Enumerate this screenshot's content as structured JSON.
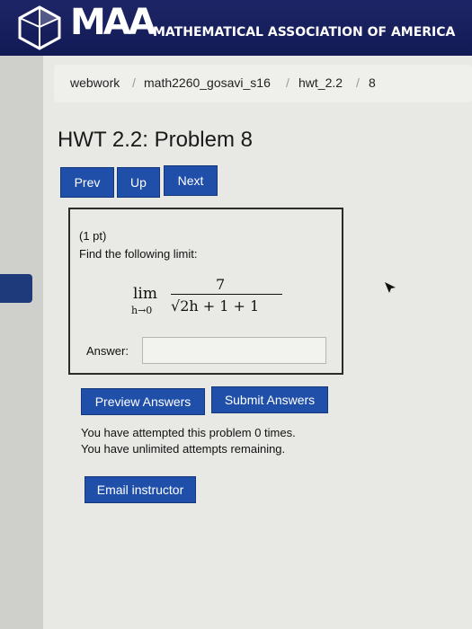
{
  "header": {
    "logo_text": "MAA",
    "org_name": "MATHEMATICAL ASSOCIATION OF AMERICA"
  },
  "breadcrumb": {
    "items": [
      "webwork",
      "math2260_gosavi_s16",
      "hwt_2.2",
      "8"
    ],
    "separator": "/"
  },
  "page": {
    "title": "HWT 2.2: Problem 8"
  },
  "nav": {
    "prev_label": "Prev",
    "up_label": "Up",
    "next_label": "Next"
  },
  "problem": {
    "points": "(1 pt)",
    "instruction": "Find the following limit:",
    "limit_word": "lim",
    "limit_subscript": "h→0",
    "numerator": "7",
    "denominator": "√2h + 1 + 1",
    "answer_label": "Answer:",
    "answer_value": ""
  },
  "actions": {
    "preview_label": "Preview Answers",
    "submit_label": "Submit Answers"
  },
  "status": {
    "attempts_line": "You have attempted this problem 0 times.",
    "remaining_line": "You have unlimited attempts remaining."
  },
  "contact": {
    "email_label": "Email instructor"
  },
  "colors": {
    "header_bg": "#121a55",
    "button_bg": "#1f4fa8",
    "page_bg": "#e8e8e4"
  }
}
